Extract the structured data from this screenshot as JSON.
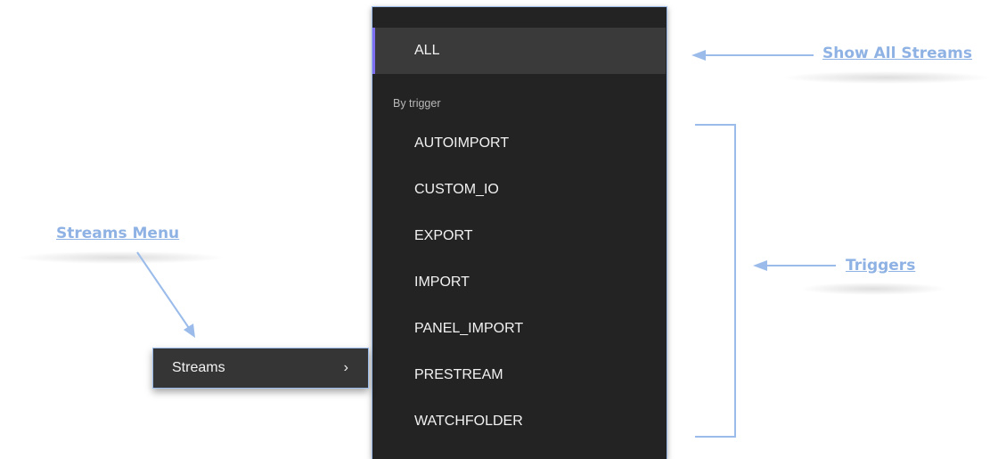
{
  "panel": {
    "all_label": "ALL",
    "section_header": "By trigger",
    "triggers": [
      "AUTOIMPORT",
      "CUSTOM_IO",
      "EXPORT",
      "IMPORT",
      "PANEL_IMPORT",
      "PRESTREAM",
      "WATCHFOLDER"
    ]
  },
  "menu": {
    "streams_label": "Streams",
    "chevron": "›"
  },
  "annotations": {
    "show_all": "Show All Streams",
    "triggers": "Triggers",
    "streams_menu": "Streams Menu"
  },
  "colors": {
    "panel_bg": "#232323",
    "selected_bg": "#3a3a3a",
    "selected_accent": "#7d6ff0",
    "annotation": "#8fb2e4"
  }
}
